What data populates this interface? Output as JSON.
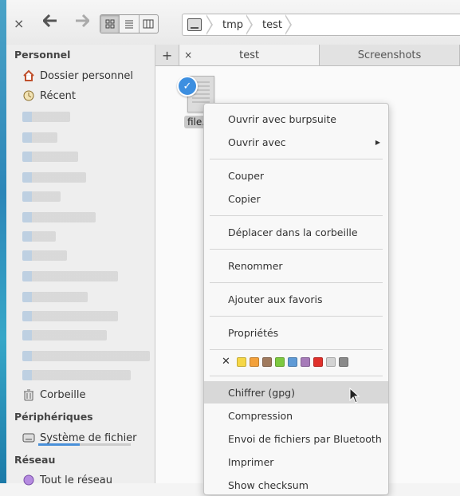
{
  "toolbar": {
    "close": "×",
    "back": "←",
    "forward": "→"
  },
  "breadcrumb": [
    "tmp",
    "test"
  ],
  "sidebar": {
    "personal_heading": "Personnel",
    "home": "Dossier personnel",
    "recent": "Récent",
    "trash": "Corbeille",
    "devices_heading": "Périphériques",
    "filesystem": "Système de fichier",
    "filesystem_usage": 0.45,
    "network_heading": "Réseau",
    "network_all": "Tout le réseau"
  },
  "tabs": {
    "add": "+",
    "close": "×",
    "items": [
      "test",
      "Screenshots"
    ]
  },
  "file": {
    "name": "file."
  },
  "menu": {
    "open_with_app": "Ouvrir avec burpsuite",
    "open_with": "Ouvrir avec",
    "cut": "Couper",
    "copy": "Copier",
    "trash": "Déplacer dans la corbeille",
    "rename": "Renommer",
    "bookmark": "Ajouter aux favoris",
    "properties": "Propriétés",
    "encrypt": "Chiffrer (gpg)",
    "compress": "Compression",
    "bluetooth": "Envoi de fichiers par Bluetooth",
    "print": "Imprimer",
    "checksum": "Show checksum"
  },
  "tag_colors": [
    "#f6d746",
    "#f3a13b",
    "#a07a5e",
    "#7dc940",
    "#5e9ad6",
    "#a67bb9",
    "#e0302b",
    "#d3d3d3",
    "#8a8a8a"
  ],
  "icons": {
    "home": "home-icon",
    "recent": "clock-icon",
    "trash": "trash-icon",
    "drive": "drive-icon",
    "network": "network-icon"
  }
}
